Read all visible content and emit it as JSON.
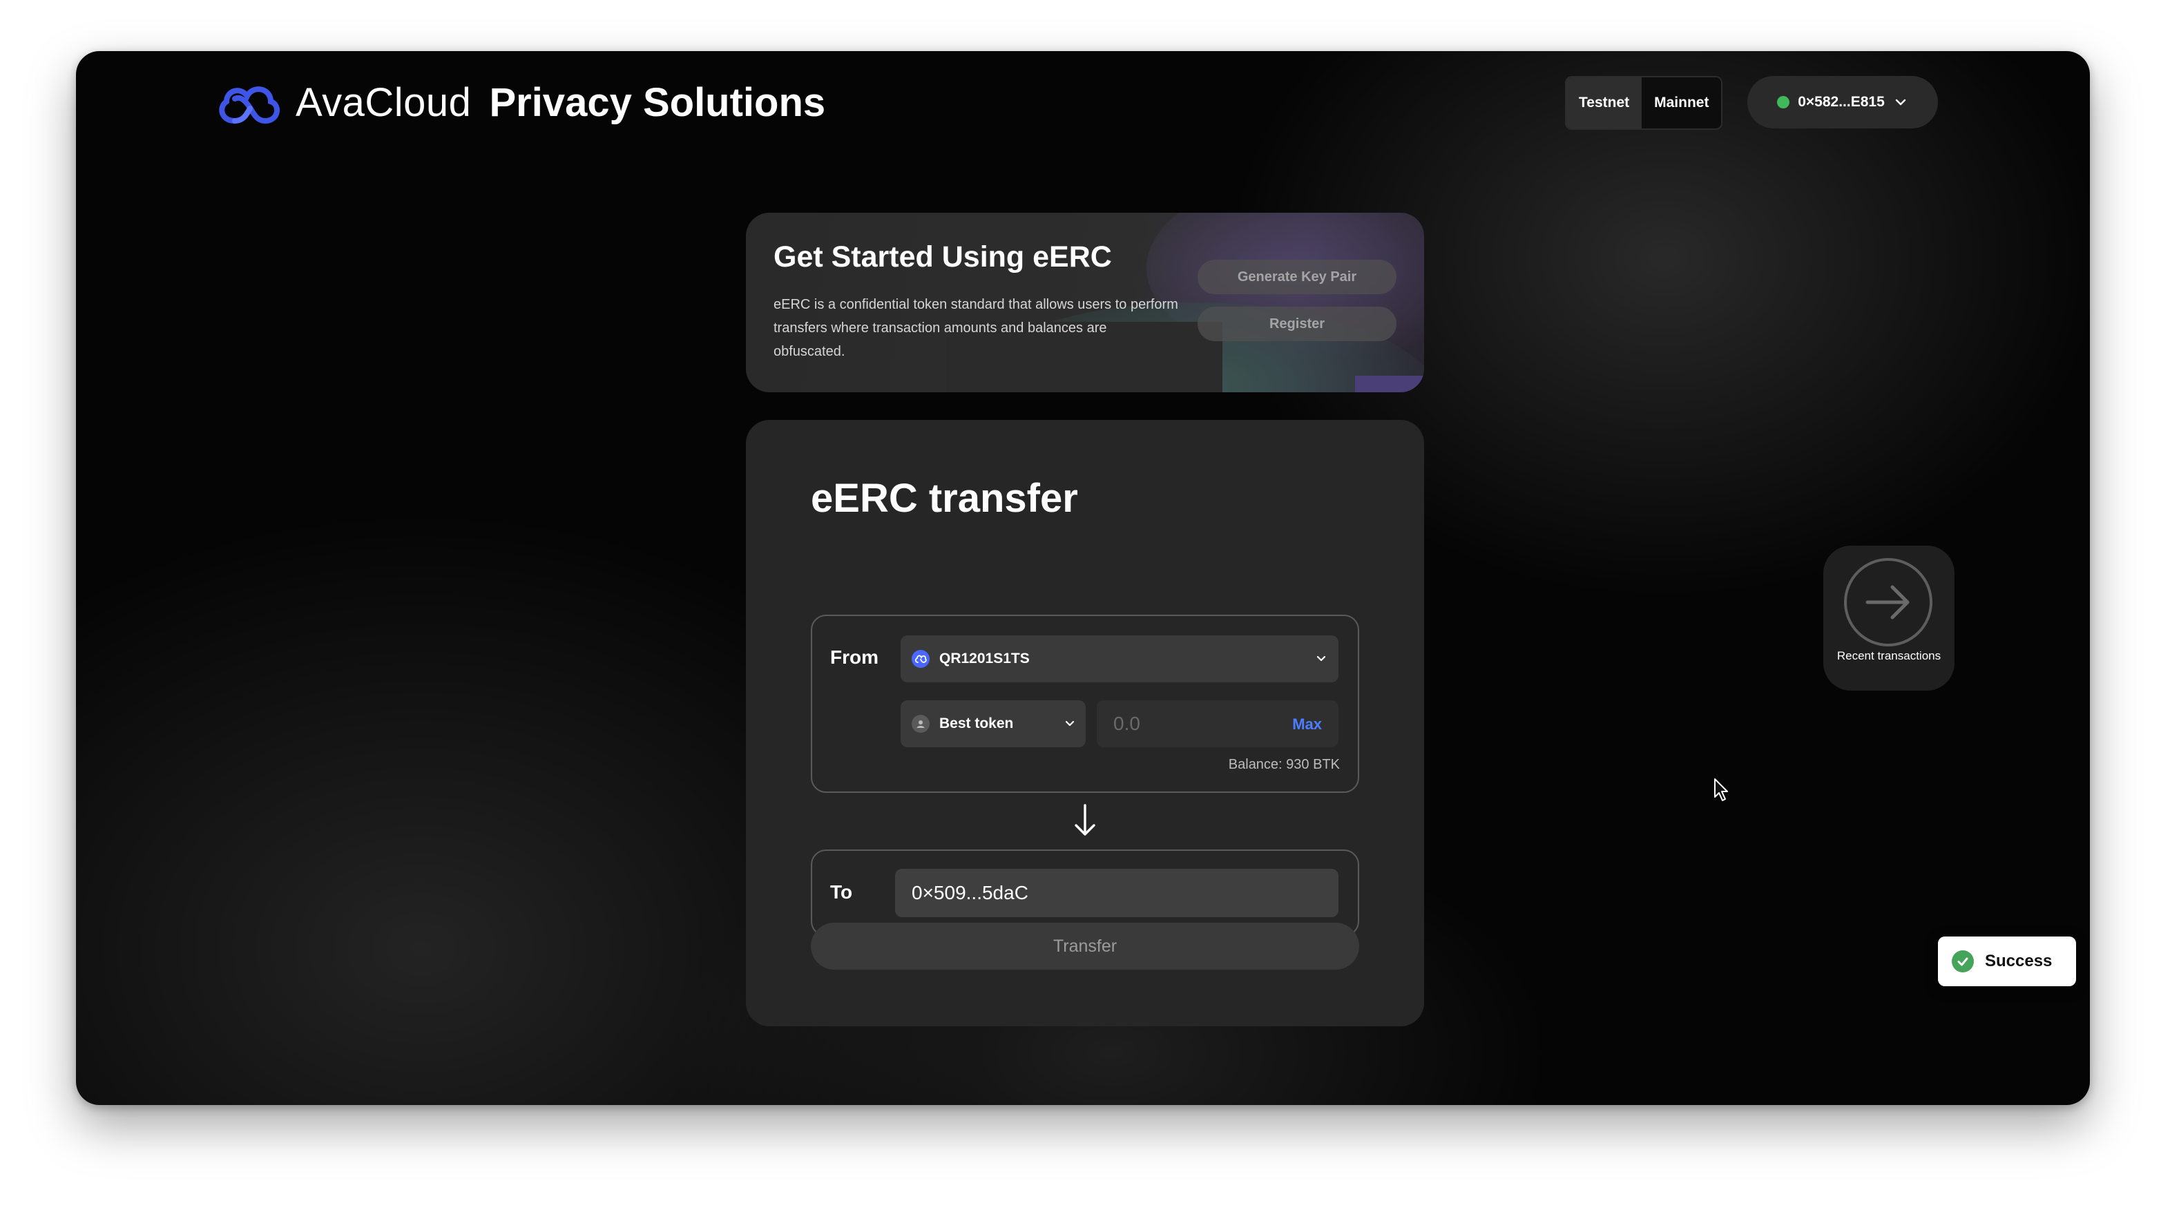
{
  "header": {
    "brand_name": "AvaCloud",
    "product_name": "Privacy Solutions",
    "network": {
      "options": [
        "Testnet",
        "Mainnet"
      ],
      "selected": "Testnet"
    },
    "wallet_address": "0×582...E815",
    "wallet_status_color": "#3fb95a"
  },
  "get_started": {
    "title": "Get Started Using eERC",
    "description": "eERC is a confidential token standard that allows users to perform transfers where transaction amounts and balances are obfuscated.",
    "generate_key_pair_label": "Generate Key Pair",
    "register_label": "Register"
  },
  "transfer": {
    "title": "eERC transfer",
    "from_label": "From",
    "from_account": "QR1201S1TS",
    "token": "Best token",
    "amount_placeholder": "0.0",
    "max_label": "Max",
    "balance": "Balance: 930 BTK",
    "to_label": "To",
    "recipient": "0×509...5daC",
    "submit_label": "Transfer"
  },
  "recent_transactions": {
    "label": "Recent transactions"
  },
  "toast": {
    "text": "Success",
    "color": "#46a35a"
  },
  "colors": {
    "accent_blue": "#4c7dff",
    "logo_blue": "#3e55e6"
  },
  "icons": [
    "avacloud-logo",
    "chevron-down-icon",
    "account-icon",
    "user-icon",
    "arrow-down-icon",
    "arrow-right-icon",
    "check-icon",
    "cursor-icon"
  ]
}
